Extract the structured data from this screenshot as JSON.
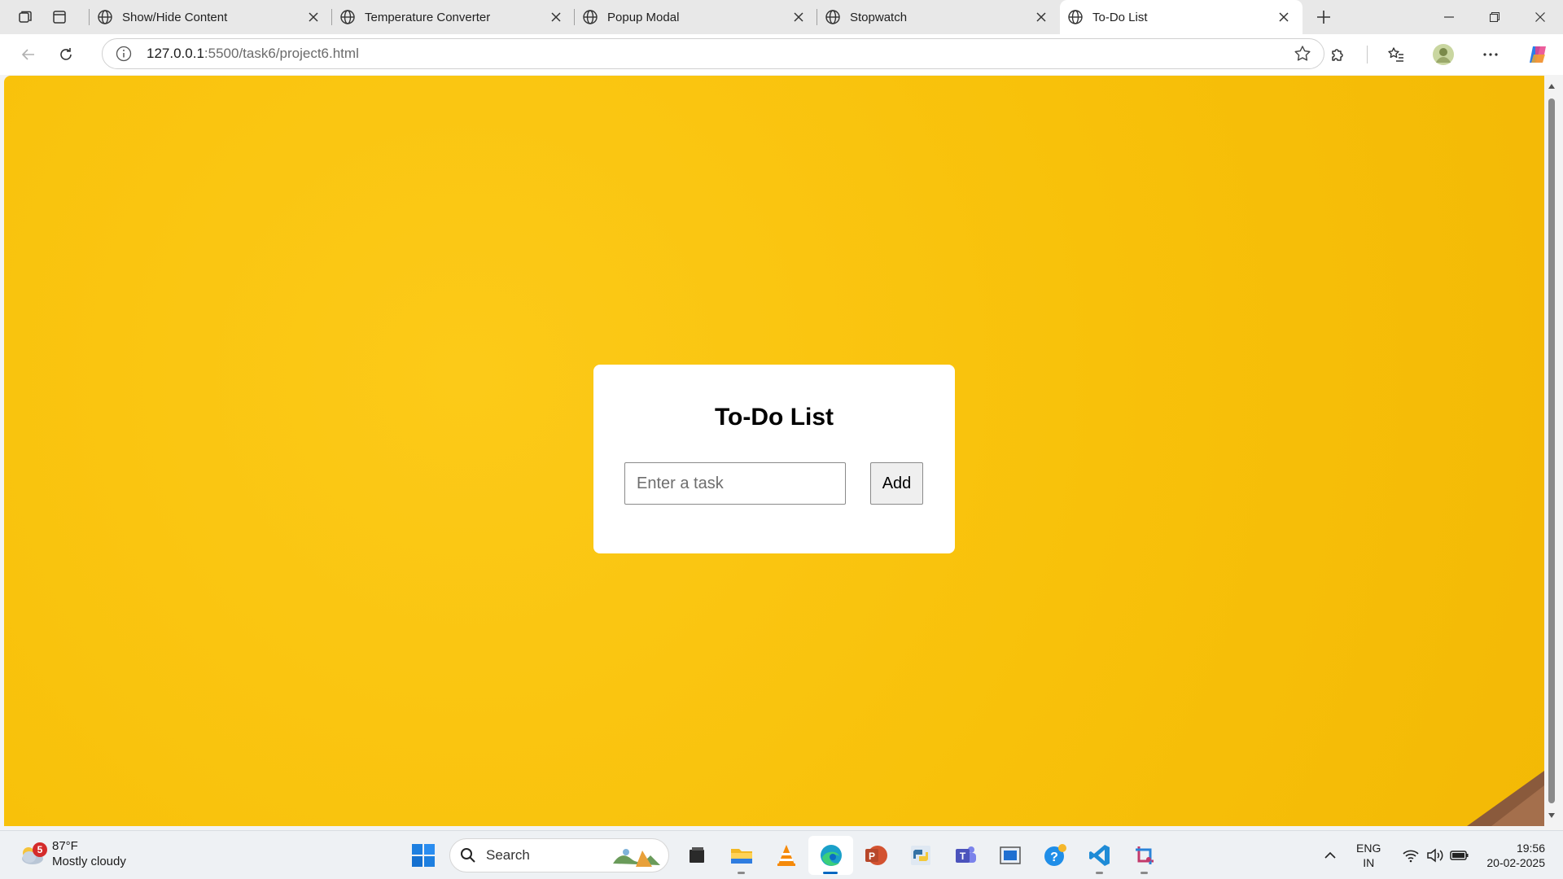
{
  "browser": {
    "tabs": [
      {
        "title": "Show/Hide Content",
        "active": false
      },
      {
        "title": "Temperature Converter",
        "active": false
      },
      {
        "title": "Popup Modal",
        "active": false
      },
      {
        "title": "Stopwatch",
        "active": false
      },
      {
        "title": "To-Do List",
        "active": true
      }
    ],
    "url_host": "127.0.0.1",
    "url_rest": ":5500/task6/project6.html"
  },
  "page": {
    "heading": "To-Do List",
    "task_placeholder": "Enter a task",
    "task_value": "",
    "add_label": "Add",
    "background_color": "#f8c10a"
  },
  "taskbar": {
    "weather_badge": "5",
    "temperature": "87°F",
    "condition": "Mostly cloudy",
    "search_label": "Search",
    "apps": [
      {
        "name": "file-manager-icon"
      },
      {
        "name": "file-explorer-icon"
      },
      {
        "name": "vlc-icon"
      },
      {
        "name": "edge-icon"
      },
      {
        "name": "powerpoint-icon"
      },
      {
        "name": "python-icon"
      },
      {
        "name": "teams-icon"
      },
      {
        "name": "window-app-icon"
      },
      {
        "name": "help-icon"
      },
      {
        "name": "vscode-icon"
      },
      {
        "name": "snipping-tool-icon"
      }
    ],
    "lang_line1": "ENG",
    "lang_line2": "IN",
    "time": "19:56",
    "date": "20-02-2025"
  }
}
